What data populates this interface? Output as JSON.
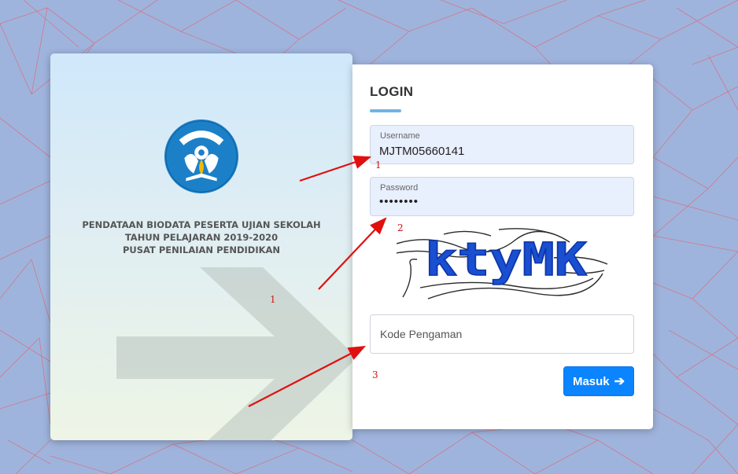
{
  "colors": {
    "page_background": "#9fb4dd",
    "network_lines": "#e0656f",
    "accent_underline": "#6fb3e6",
    "field_fill": "#e8effd",
    "button": "#0a84ff",
    "annotation": "#d21414"
  },
  "left_panel": {
    "logo_text": "TUT WURI HANDAYANI",
    "title_lines": [
      "PENDATAAN BIODATA PESERTA UJIAN SEKOLAH",
      "TAHUN PELAJARAN 2019-2020",
      "PUSAT PENILAIAN PENDIDIKAN"
    ]
  },
  "login": {
    "title": "LOGIN",
    "username": {
      "label": "Username",
      "value": "MJTM05660141"
    },
    "password": {
      "label": "Password",
      "value": "••••••••"
    },
    "captcha_text": "ktyMK",
    "code": {
      "placeholder": "Kode Pengaman",
      "value": ""
    },
    "submit_label": "Masuk",
    "submit_icon": "arrow-right-icon"
  },
  "annotations": {
    "markers": [
      "1",
      "1",
      "2",
      "3"
    ]
  }
}
